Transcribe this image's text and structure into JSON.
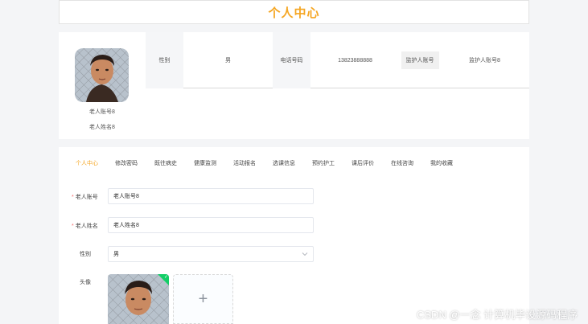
{
  "page": {
    "title": "个人中心"
  },
  "profile": {
    "account": "老人账号8",
    "name": "老人姓名8",
    "info": [
      {
        "label": "性别",
        "value": "男"
      },
      {
        "label": "电话号码",
        "value": "13823888888"
      },
      {
        "label": "监护人账号",
        "value": "监护人账号8"
      }
    ]
  },
  "tabs": [
    {
      "label": "个人中心",
      "active": true
    },
    {
      "label": "修改密码",
      "active": false
    },
    {
      "label": "既往病史",
      "active": false
    },
    {
      "label": "健康监测",
      "active": false
    },
    {
      "label": "活动报名",
      "active": false
    },
    {
      "label": "选课信息",
      "active": false
    },
    {
      "label": "预约护工",
      "active": false
    },
    {
      "label": "课后评价",
      "active": false
    },
    {
      "label": "在线咨询",
      "active": false
    },
    {
      "label": "我的收藏",
      "active": false
    }
  ],
  "form": {
    "account_label": "老人账号",
    "account_value": "老人账号8",
    "name_label": "老人姓名",
    "name_value": "老人姓名8",
    "gender_label": "性别",
    "gender_value": "男",
    "avatar_label": "头像",
    "required_mark": "*",
    "add_symbol": "+"
  },
  "watermark": "CSDN @一念 计算机毕设源码程序",
  "colors": {
    "accent": "#f5a623",
    "required": "#f56c6c",
    "success": "#13ce66"
  }
}
